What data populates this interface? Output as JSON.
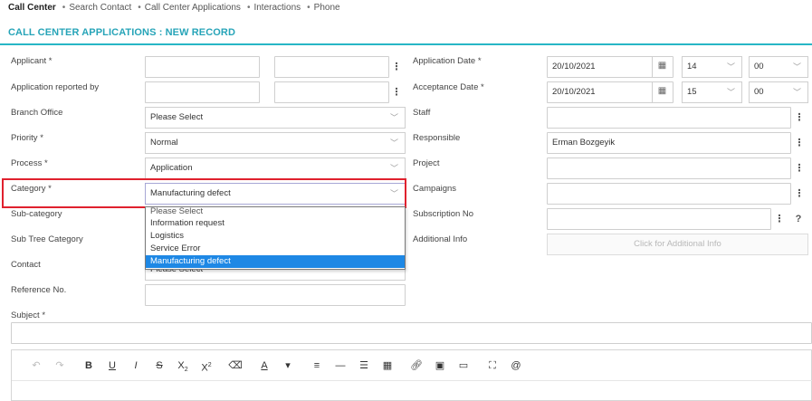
{
  "nav": {
    "items": [
      "Call Center",
      "Search Contact",
      "Call Center Applications",
      "Interactions",
      "Phone"
    ]
  },
  "page": {
    "title": "CALL CENTER APPLICATIONS : NEW RECORD"
  },
  "form": {
    "applicant": {
      "label": "Applicant *"
    },
    "reported_by": {
      "label": "Application reported by"
    },
    "branch_office": {
      "label": "Branch Office",
      "value": "Please Select"
    },
    "priority": {
      "label": "Priority *",
      "value": "Normal"
    },
    "process": {
      "label": "Process *",
      "value": "Application"
    },
    "category": {
      "label": "Category *",
      "value": "Manufacturing defect"
    },
    "sub_category": {
      "label": "Sub-category"
    },
    "sub_tree_category": {
      "label": "Sub Tree Category"
    },
    "contact": {
      "label": "Contact",
      "value": "Please Select"
    },
    "reference_no": {
      "label": "Reference No."
    },
    "subject": {
      "label": "Subject *"
    },
    "application_date": {
      "label": "Application Date *",
      "date": "20/10/2021",
      "hour": "14",
      "minute": "00"
    },
    "acceptance_date": {
      "label": "Acceptance Date *",
      "date": "20/10/2021",
      "hour": "15",
      "minute": "00"
    },
    "staff": {
      "label": "Staff"
    },
    "responsible": {
      "label": "Responsible",
      "value": "Erman Bozgeyik"
    },
    "project": {
      "label": "Project"
    },
    "campaigns": {
      "label": "Campaigns"
    },
    "subscription_no": {
      "label": "Subscription No",
      "help": "?"
    },
    "additional_info": {
      "label": "Additional Info",
      "button": "Click for Additional Info"
    }
  },
  "category_dropdown": {
    "options": [
      "Please Select",
      "Information request",
      "Logistics",
      "Service Error",
      "Manufacturing defect"
    ],
    "selected": "Manufacturing defect"
  },
  "icons": {
    "more": "⋮",
    "calendar": "calendar-icon",
    "chevron": "chevron-down-icon"
  },
  "colors": {
    "accent": "#27a4b8",
    "highlight": "#e0212e",
    "selected_option": "#1e88e5"
  },
  "toolbar": {
    "bold": "B",
    "underline": "U",
    "italic": "I",
    "strike": "S",
    "subscript": "X",
    "sub_mark": "2",
    "superscript": "X",
    "sup_mark": "2"
  }
}
